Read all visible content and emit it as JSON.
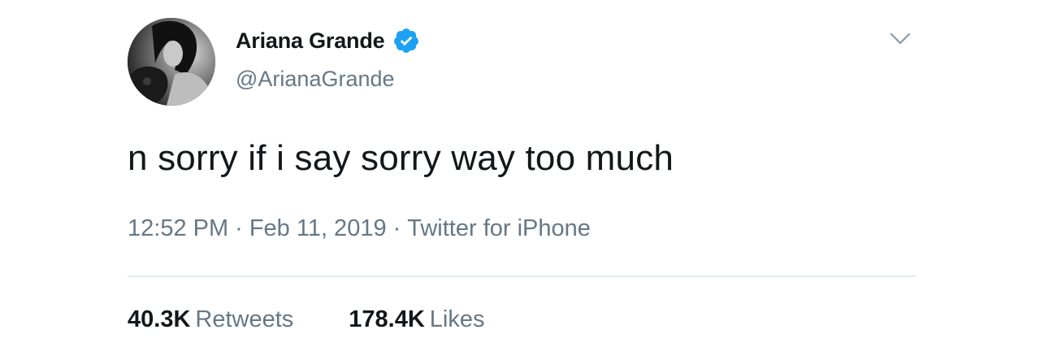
{
  "user": {
    "display_name": "Ariana Grande",
    "handle": "@ArianaGrande",
    "verified": true
  },
  "tweet": {
    "text": "n sorry if i say sorry way too much",
    "time": "12:52 PM",
    "separator": "·",
    "date": "Feb 11, 2019",
    "source": "Twitter for iPhone"
  },
  "stats": {
    "retweets_count": "40.3K",
    "retweets_label": "Retweets",
    "likes_count": "178.4K",
    "likes_label": "Likes"
  },
  "icons": {
    "verified": "verified-badge-icon",
    "menu": "chevron-down-icon"
  },
  "colors": {
    "text_primary": "#14171a",
    "text_secondary": "#657786",
    "verified_blue": "#1da1f2",
    "divider": "#e6ecf0"
  }
}
